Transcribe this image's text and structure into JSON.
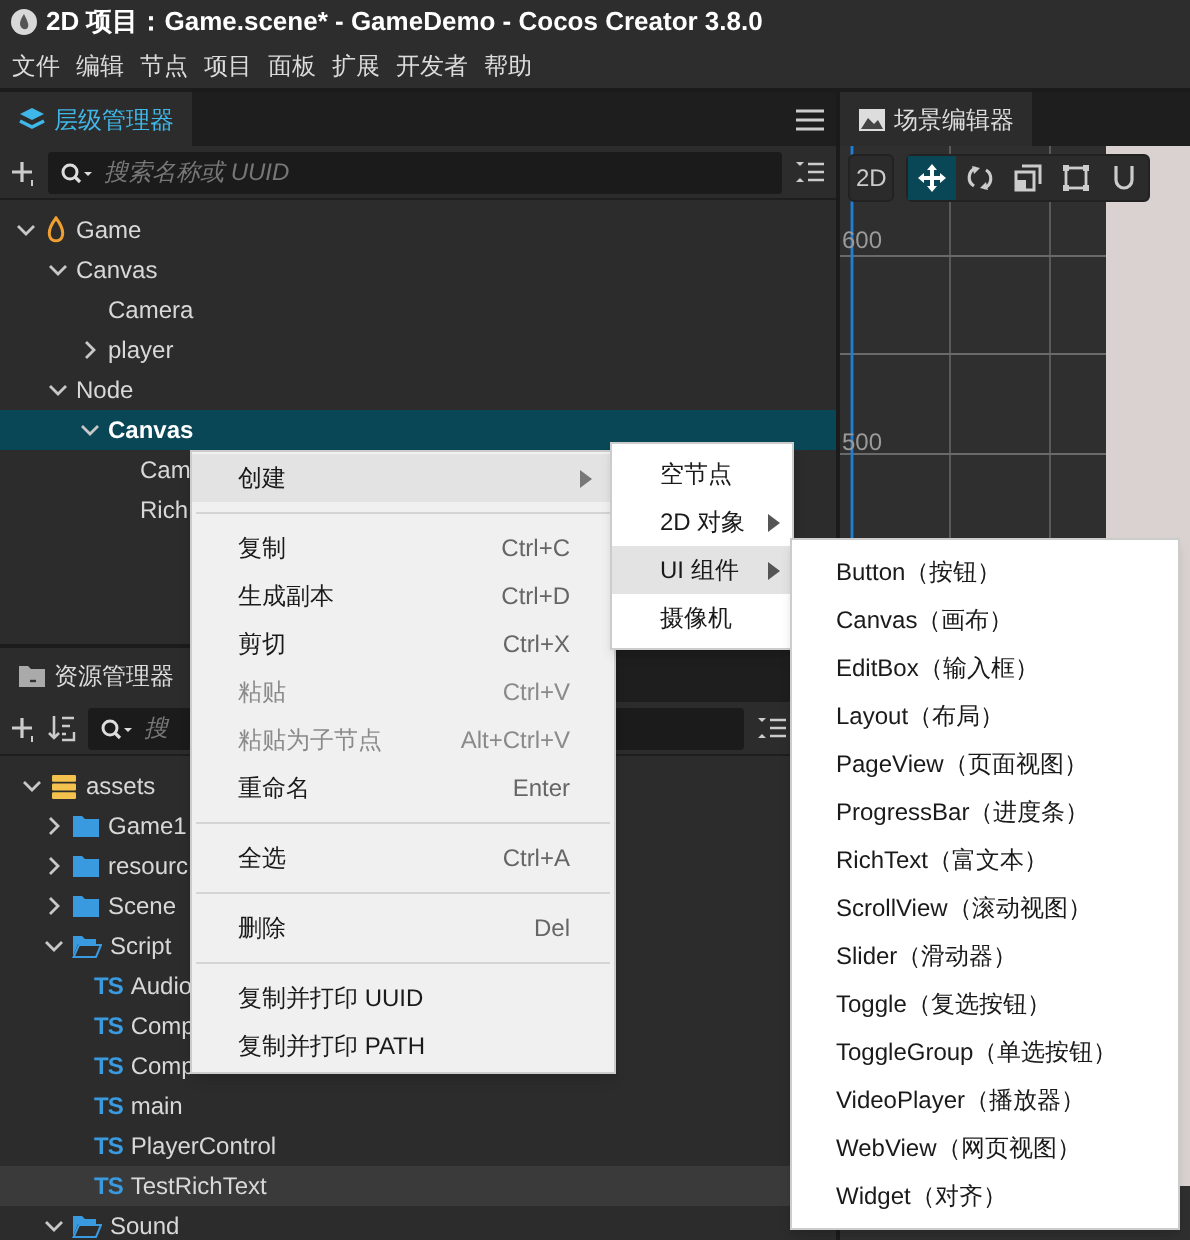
{
  "window": {
    "title": "2D 项目：Game.scene* - GameDemo - Cocos Creator 3.8.0"
  },
  "menu_bar": [
    "文件",
    "编辑",
    "节点",
    "项目",
    "面板",
    "扩展",
    "开发者",
    "帮助"
  ],
  "hierarchy": {
    "title": "层级管理器",
    "search": {
      "placeholder": "搜索名称或 UUID"
    },
    "tree": [
      {
        "label": "Game",
        "kind": "scene",
        "expanded": true,
        "selected": false,
        "children": [
          {
            "label": "Canvas",
            "expanded": true,
            "selected": false,
            "children": [
              {
                "label": "Camera",
                "selected": false
              },
              {
                "label": "player",
                "expanded": false,
                "selected": false
              }
            ]
          },
          {
            "label": "Node",
            "expanded": true,
            "selected": false,
            "children": [
              {
                "label": "Canvas",
                "expanded": true,
                "selected": true,
                "children": [
                  {
                    "label": "Cam",
                    "selected": false
                  },
                  {
                    "label": "Rich",
                    "selected": false
                  }
                ]
              }
            ]
          }
        ]
      }
    ]
  },
  "assets": {
    "title": "资源管理器",
    "search": {
      "placeholder": "搜"
    },
    "tree": [
      {
        "label": "assets",
        "kind": "db",
        "expanded": true,
        "selected": false,
        "children": [
          {
            "label": "Game1",
            "kind": "folder",
            "expanded": false,
            "selected": false
          },
          {
            "label": "resourc",
            "kind": "folder",
            "expanded": false,
            "selected": false
          },
          {
            "label": "Scene",
            "kind": "folder",
            "expanded": false,
            "selected": false
          },
          {
            "label": "Script",
            "kind": "folder",
            "expanded": true,
            "selected": false,
            "children": [
              {
                "label": "Audio",
                "kind": "ts",
                "badge": "TS",
                "selected": false
              },
              {
                "label": "Comp",
                "kind": "ts",
                "badge": "TS",
                "selected": false
              },
              {
                "label": "Comp",
                "kind": "ts",
                "badge": "TS",
                "selected": false
              },
              {
                "label": "main",
                "kind": "ts",
                "badge": "TS",
                "selected": false
              },
              {
                "label": "PlayerControl",
                "kind": "ts",
                "badge": "TS",
                "selected": false
              },
              {
                "label": "TestRichText",
                "kind": "ts",
                "badge": "TS",
                "selected": true
              }
            ]
          },
          {
            "label": "Sound",
            "kind": "folder",
            "expanded": true,
            "selected": false
          }
        ]
      }
    ]
  },
  "scene": {
    "title": "场景编辑器",
    "mode": "2D",
    "tools": [
      {
        "kind": "move",
        "selected": true
      },
      {
        "kind": "rotate",
        "selected": false
      },
      {
        "kind": "scale",
        "selected": false
      },
      {
        "kind": "rect",
        "selected": false
      },
      {
        "kind": "magnet",
        "selected": false
      }
    ],
    "ruler": [
      "600",
      "500"
    ]
  },
  "context_menu": [
    {
      "kind": "item",
      "label": "创建",
      "submenu": true,
      "selected": true,
      "disabled": false
    },
    {
      "kind": "separator"
    },
    {
      "kind": "item",
      "label": "复制",
      "shortcut": "Ctrl+C",
      "submenu": false,
      "selected": false,
      "disabled": false
    },
    {
      "kind": "item",
      "label": "生成副本",
      "shortcut": "Ctrl+D",
      "submenu": false,
      "selected": false,
      "disabled": false
    },
    {
      "kind": "item",
      "label": "剪切",
      "shortcut": "Ctrl+X",
      "submenu": false,
      "selected": false,
      "disabled": false
    },
    {
      "kind": "item",
      "label": "粘贴",
      "shortcut": "Ctrl+V",
      "submenu": false,
      "selected": false,
      "disabled": true
    },
    {
      "kind": "item",
      "label": "粘贴为子节点",
      "shortcut": "Alt+Ctrl+V",
      "submenu": false,
      "selected": false,
      "disabled": true
    },
    {
      "kind": "item",
      "label": "重命名",
      "shortcut": "Enter",
      "submenu": false,
      "selected": false,
      "disabled": false
    },
    {
      "kind": "separator"
    },
    {
      "kind": "item",
      "label": "全选",
      "shortcut": "Ctrl+A",
      "submenu": false,
      "selected": false,
      "disabled": false
    },
    {
      "kind": "separator"
    },
    {
      "kind": "item",
      "label": "删除",
      "shortcut": "Del",
      "submenu": false,
      "selected": false,
      "disabled": false
    },
    {
      "kind": "separator"
    },
    {
      "kind": "item",
      "label": "复制并打印 UUID",
      "submenu": false,
      "selected": false,
      "disabled": false
    },
    {
      "kind": "item",
      "label": "复制并打印 PATH",
      "submenu": false,
      "selected": false,
      "disabled": false
    }
  ],
  "create_submenu": [
    {
      "label": "空节点",
      "submenu": false,
      "selected": false
    },
    {
      "label": "2D 对象",
      "submenu": true,
      "selected": false
    },
    {
      "label": "UI 组件",
      "submenu": true,
      "selected": true
    },
    {
      "label": "摄像机",
      "submenu": false,
      "selected": false
    }
  ],
  "ui_submenu": [
    "Button（按钮）",
    "Canvas（画布）",
    "EditBox（输入框）",
    "Layout（布局）",
    "PageView（页面视图）",
    "ProgressBar（进度条）",
    "RichText（富文本）",
    "ScrollView（滚动视图）",
    "Slider（滑动器）",
    "Toggle（复选按钮）",
    "ToggleGroup（单选按钮）",
    "VideoPlayer（播放器）",
    "WebView（网页视图）",
    "Widget（对齐）"
  ]
}
